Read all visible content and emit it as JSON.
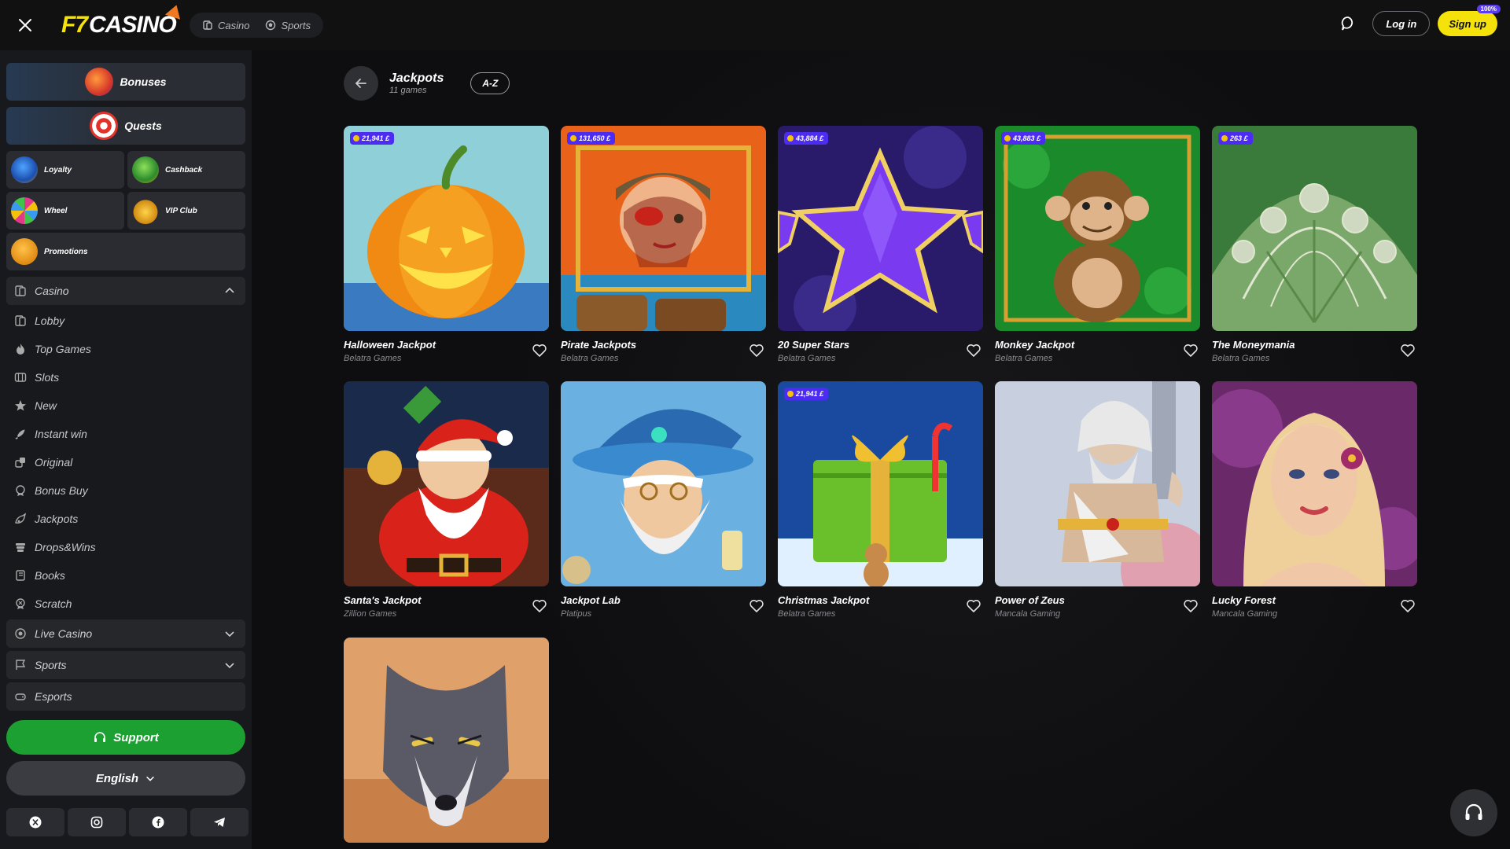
{
  "brand": {
    "logo_text_f7": "F7",
    "logo_text_casino": "CASINO"
  },
  "top_tabs": [
    {
      "label": "Casino",
      "icon": "casino-icon"
    },
    {
      "label": "Sports",
      "icon": "sports-icon"
    }
  ],
  "auth": {
    "login_label": "Log in",
    "signup_label": "Sign up",
    "signup_badge": "100%"
  },
  "sidebar": {
    "bonuses_label": "Bonuses",
    "quests_label": "Quests",
    "promo_grid": [
      {
        "label": "Loyalty",
        "icon": "shield-icon"
      },
      {
        "label": "Cashback",
        "icon": "cashback-icon"
      },
      {
        "label": "Wheel",
        "icon": "wheel-icon"
      },
      {
        "label": "VIP Club",
        "icon": "crown-icon"
      }
    ],
    "promotions_label": "Promotions",
    "casino_section": "Casino",
    "casino_items": [
      {
        "label": "Lobby",
        "icon": "lobby-icon"
      },
      {
        "label": "Top Games",
        "icon": "fire-icon"
      },
      {
        "label": "Slots",
        "icon": "slots-icon"
      },
      {
        "label": "New",
        "icon": "star-icon"
      },
      {
        "label": "Instant win",
        "icon": "rocket-icon"
      },
      {
        "label": "Original",
        "icon": "original-icon"
      },
      {
        "label": "Bonus Buy",
        "icon": "bonus-buy-icon"
      },
      {
        "label": "Jackpots",
        "icon": "jackpots-icon"
      },
      {
        "label": "Drops&Wins",
        "icon": "drops-icon"
      },
      {
        "label": "Books",
        "icon": "book-icon"
      },
      {
        "label": "Scratch",
        "icon": "scratch-icon"
      }
    ],
    "live_casino_label": "Live Casino",
    "sports_label": "Sports",
    "esports_label": "Esports",
    "support_label": "Support",
    "language_label": "English",
    "socials": [
      "x-icon",
      "instagram-icon",
      "facebook-icon",
      "telegram-icon"
    ]
  },
  "main": {
    "title": "Jackpots",
    "subtitle": "11 games",
    "sort_label": "A-Z",
    "games": [
      {
        "name": "Halloween Jackpot",
        "provider": "Belatra Games",
        "jackpot": "21,941 £",
        "theme": "pumpkin"
      },
      {
        "name": "Pirate Jackpots",
        "provider": "Belatra Games",
        "jackpot": "131,650 £",
        "theme": "pirate"
      },
      {
        "name": "20 Super Stars",
        "provider": "Belatra Games",
        "jackpot": "43,884 £",
        "theme": "stars"
      },
      {
        "name": "Monkey Jackpot",
        "provider": "Belatra Games",
        "jackpot": "43,883 £",
        "theme": "monkey"
      },
      {
        "name": "The Moneymania",
        "provider": "Belatra Games",
        "jackpot": "263 £",
        "theme": "money"
      },
      {
        "name": "Santa's Jackpot",
        "provider": "Zillion Games",
        "jackpot": "",
        "theme": "santa"
      },
      {
        "name": "Jackpot Lab",
        "provider": "Platipus",
        "jackpot": "",
        "theme": "wizard"
      },
      {
        "name": "Christmas Jackpot",
        "provider": "Belatra Games",
        "jackpot": "21,941 £",
        "theme": "gift"
      },
      {
        "name": "Power of Zeus",
        "provider": "Mancala Gaming",
        "jackpot": "",
        "theme": "zeus"
      },
      {
        "name": "Lucky Forest",
        "provider": "Mancala Gaming",
        "jackpot": "",
        "theme": "lady"
      },
      {
        "name": "",
        "provider": "",
        "jackpot": "",
        "theme": "wolf"
      }
    ]
  },
  "colors": {
    "accent": "#f5e20a",
    "support": "#1da032",
    "badge": "#4b2cf0",
    "sidebar": "#18191c",
    "bg": "#0e0e10"
  }
}
